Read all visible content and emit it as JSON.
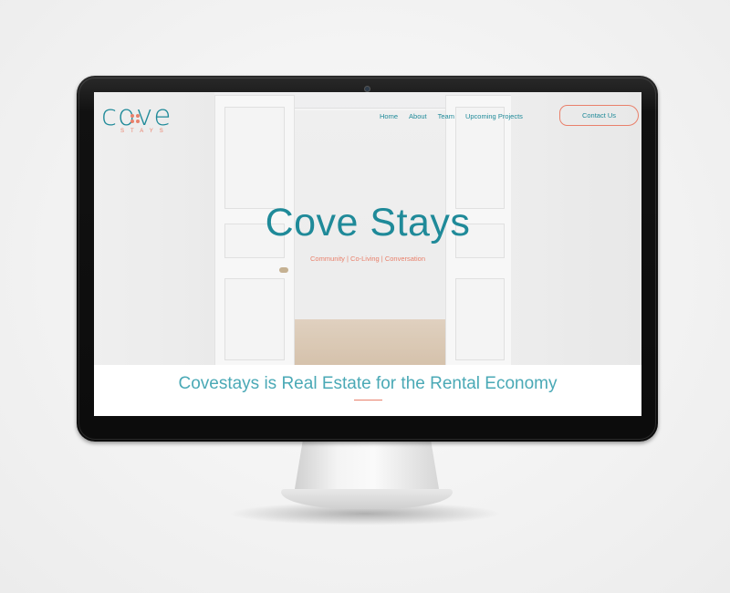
{
  "logo": {
    "word": "cove",
    "sub": "STAYS"
  },
  "nav": {
    "items": [
      {
        "label": "Home"
      },
      {
        "label": "About"
      },
      {
        "label": "Team"
      },
      {
        "label": "Upcoming Projects"
      }
    ],
    "contact_label": "Contact Us"
  },
  "hero": {
    "title": "Cove Stays",
    "subtitle": "Community | Co-Living | Conversation"
  },
  "band": {
    "tagline": "Covestays is Real Estate for the Rental Economy"
  },
  "colors": {
    "teal": "#1f8a99",
    "coral": "#e9806b",
    "bezel": "#0c0c0c"
  }
}
